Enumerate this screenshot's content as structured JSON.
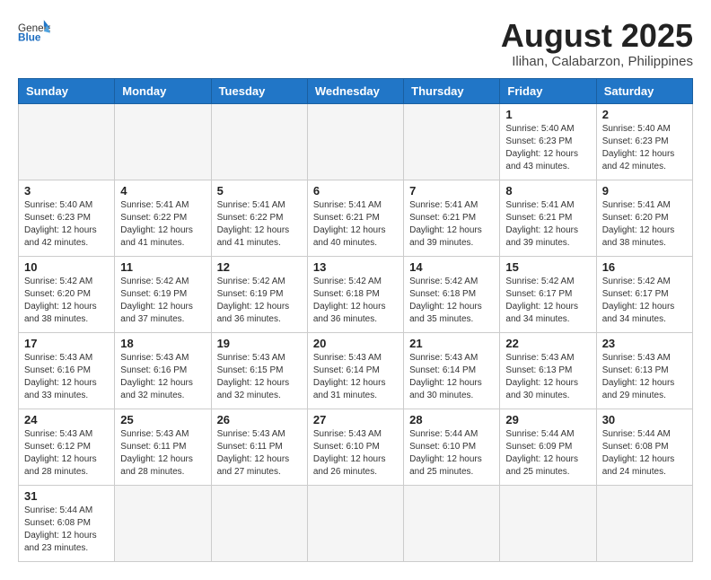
{
  "header": {
    "logo_general": "General",
    "logo_blue": "Blue",
    "month_year": "August 2025",
    "location": "Ilihan, Calabarzon, Philippines"
  },
  "weekdays": [
    "Sunday",
    "Monday",
    "Tuesday",
    "Wednesday",
    "Thursday",
    "Friday",
    "Saturday"
  ],
  "weeks": [
    [
      {
        "day": "",
        "info": ""
      },
      {
        "day": "",
        "info": ""
      },
      {
        "day": "",
        "info": ""
      },
      {
        "day": "",
        "info": ""
      },
      {
        "day": "",
        "info": ""
      },
      {
        "day": "1",
        "info": "Sunrise: 5:40 AM\nSunset: 6:23 PM\nDaylight: 12 hours\nand 43 minutes."
      },
      {
        "day": "2",
        "info": "Sunrise: 5:40 AM\nSunset: 6:23 PM\nDaylight: 12 hours\nand 42 minutes."
      }
    ],
    [
      {
        "day": "3",
        "info": "Sunrise: 5:40 AM\nSunset: 6:23 PM\nDaylight: 12 hours\nand 42 minutes."
      },
      {
        "day": "4",
        "info": "Sunrise: 5:41 AM\nSunset: 6:22 PM\nDaylight: 12 hours\nand 41 minutes."
      },
      {
        "day": "5",
        "info": "Sunrise: 5:41 AM\nSunset: 6:22 PM\nDaylight: 12 hours\nand 41 minutes."
      },
      {
        "day": "6",
        "info": "Sunrise: 5:41 AM\nSunset: 6:21 PM\nDaylight: 12 hours\nand 40 minutes."
      },
      {
        "day": "7",
        "info": "Sunrise: 5:41 AM\nSunset: 6:21 PM\nDaylight: 12 hours\nand 39 minutes."
      },
      {
        "day": "8",
        "info": "Sunrise: 5:41 AM\nSunset: 6:21 PM\nDaylight: 12 hours\nand 39 minutes."
      },
      {
        "day": "9",
        "info": "Sunrise: 5:41 AM\nSunset: 6:20 PM\nDaylight: 12 hours\nand 38 minutes."
      }
    ],
    [
      {
        "day": "10",
        "info": "Sunrise: 5:42 AM\nSunset: 6:20 PM\nDaylight: 12 hours\nand 38 minutes."
      },
      {
        "day": "11",
        "info": "Sunrise: 5:42 AM\nSunset: 6:19 PM\nDaylight: 12 hours\nand 37 minutes."
      },
      {
        "day": "12",
        "info": "Sunrise: 5:42 AM\nSunset: 6:19 PM\nDaylight: 12 hours\nand 36 minutes."
      },
      {
        "day": "13",
        "info": "Sunrise: 5:42 AM\nSunset: 6:18 PM\nDaylight: 12 hours\nand 36 minutes."
      },
      {
        "day": "14",
        "info": "Sunrise: 5:42 AM\nSunset: 6:18 PM\nDaylight: 12 hours\nand 35 minutes."
      },
      {
        "day": "15",
        "info": "Sunrise: 5:42 AM\nSunset: 6:17 PM\nDaylight: 12 hours\nand 34 minutes."
      },
      {
        "day": "16",
        "info": "Sunrise: 5:42 AM\nSunset: 6:17 PM\nDaylight: 12 hours\nand 34 minutes."
      }
    ],
    [
      {
        "day": "17",
        "info": "Sunrise: 5:43 AM\nSunset: 6:16 PM\nDaylight: 12 hours\nand 33 minutes."
      },
      {
        "day": "18",
        "info": "Sunrise: 5:43 AM\nSunset: 6:16 PM\nDaylight: 12 hours\nand 32 minutes."
      },
      {
        "day": "19",
        "info": "Sunrise: 5:43 AM\nSunset: 6:15 PM\nDaylight: 12 hours\nand 32 minutes."
      },
      {
        "day": "20",
        "info": "Sunrise: 5:43 AM\nSunset: 6:14 PM\nDaylight: 12 hours\nand 31 minutes."
      },
      {
        "day": "21",
        "info": "Sunrise: 5:43 AM\nSunset: 6:14 PM\nDaylight: 12 hours\nand 30 minutes."
      },
      {
        "day": "22",
        "info": "Sunrise: 5:43 AM\nSunset: 6:13 PM\nDaylight: 12 hours\nand 30 minutes."
      },
      {
        "day": "23",
        "info": "Sunrise: 5:43 AM\nSunset: 6:13 PM\nDaylight: 12 hours\nand 29 minutes."
      }
    ],
    [
      {
        "day": "24",
        "info": "Sunrise: 5:43 AM\nSunset: 6:12 PM\nDaylight: 12 hours\nand 28 minutes."
      },
      {
        "day": "25",
        "info": "Sunrise: 5:43 AM\nSunset: 6:11 PM\nDaylight: 12 hours\nand 28 minutes."
      },
      {
        "day": "26",
        "info": "Sunrise: 5:43 AM\nSunset: 6:11 PM\nDaylight: 12 hours\nand 27 minutes."
      },
      {
        "day": "27",
        "info": "Sunrise: 5:43 AM\nSunset: 6:10 PM\nDaylight: 12 hours\nand 26 minutes."
      },
      {
        "day": "28",
        "info": "Sunrise: 5:44 AM\nSunset: 6:10 PM\nDaylight: 12 hours\nand 25 minutes."
      },
      {
        "day": "29",
        "info": "Sunrise: 5:44 AM\nSunset: 6:09 PM\nDaylight: 12 hours\nand 25 minutes."
      },
      {
        "day": "30",
        "info": "Sunrise: 5:44 AM\nSunset: 6:08 PM\nDaylight: 12 hours\nand 24 minutes."
      }
    ],
    [
      {
        "day": "31",
        "info": "Sunrise: 5:44 AM\nSunset: 6:08 PM\nDaylight: 12 hours\nand 23 minutes."
      },
      {
        "day": "",
        "info": ""
      },
      {
        "day": "",
        "info": ""
      },
      {
        "day": "",
        "info": ""
      },
      {
        "day": "",
        "info": ""
      },
      {
        "day": "",
        "info": ""
      },
      {
        "day": "",
        "info": ""
      }
    ]
  ]
}
